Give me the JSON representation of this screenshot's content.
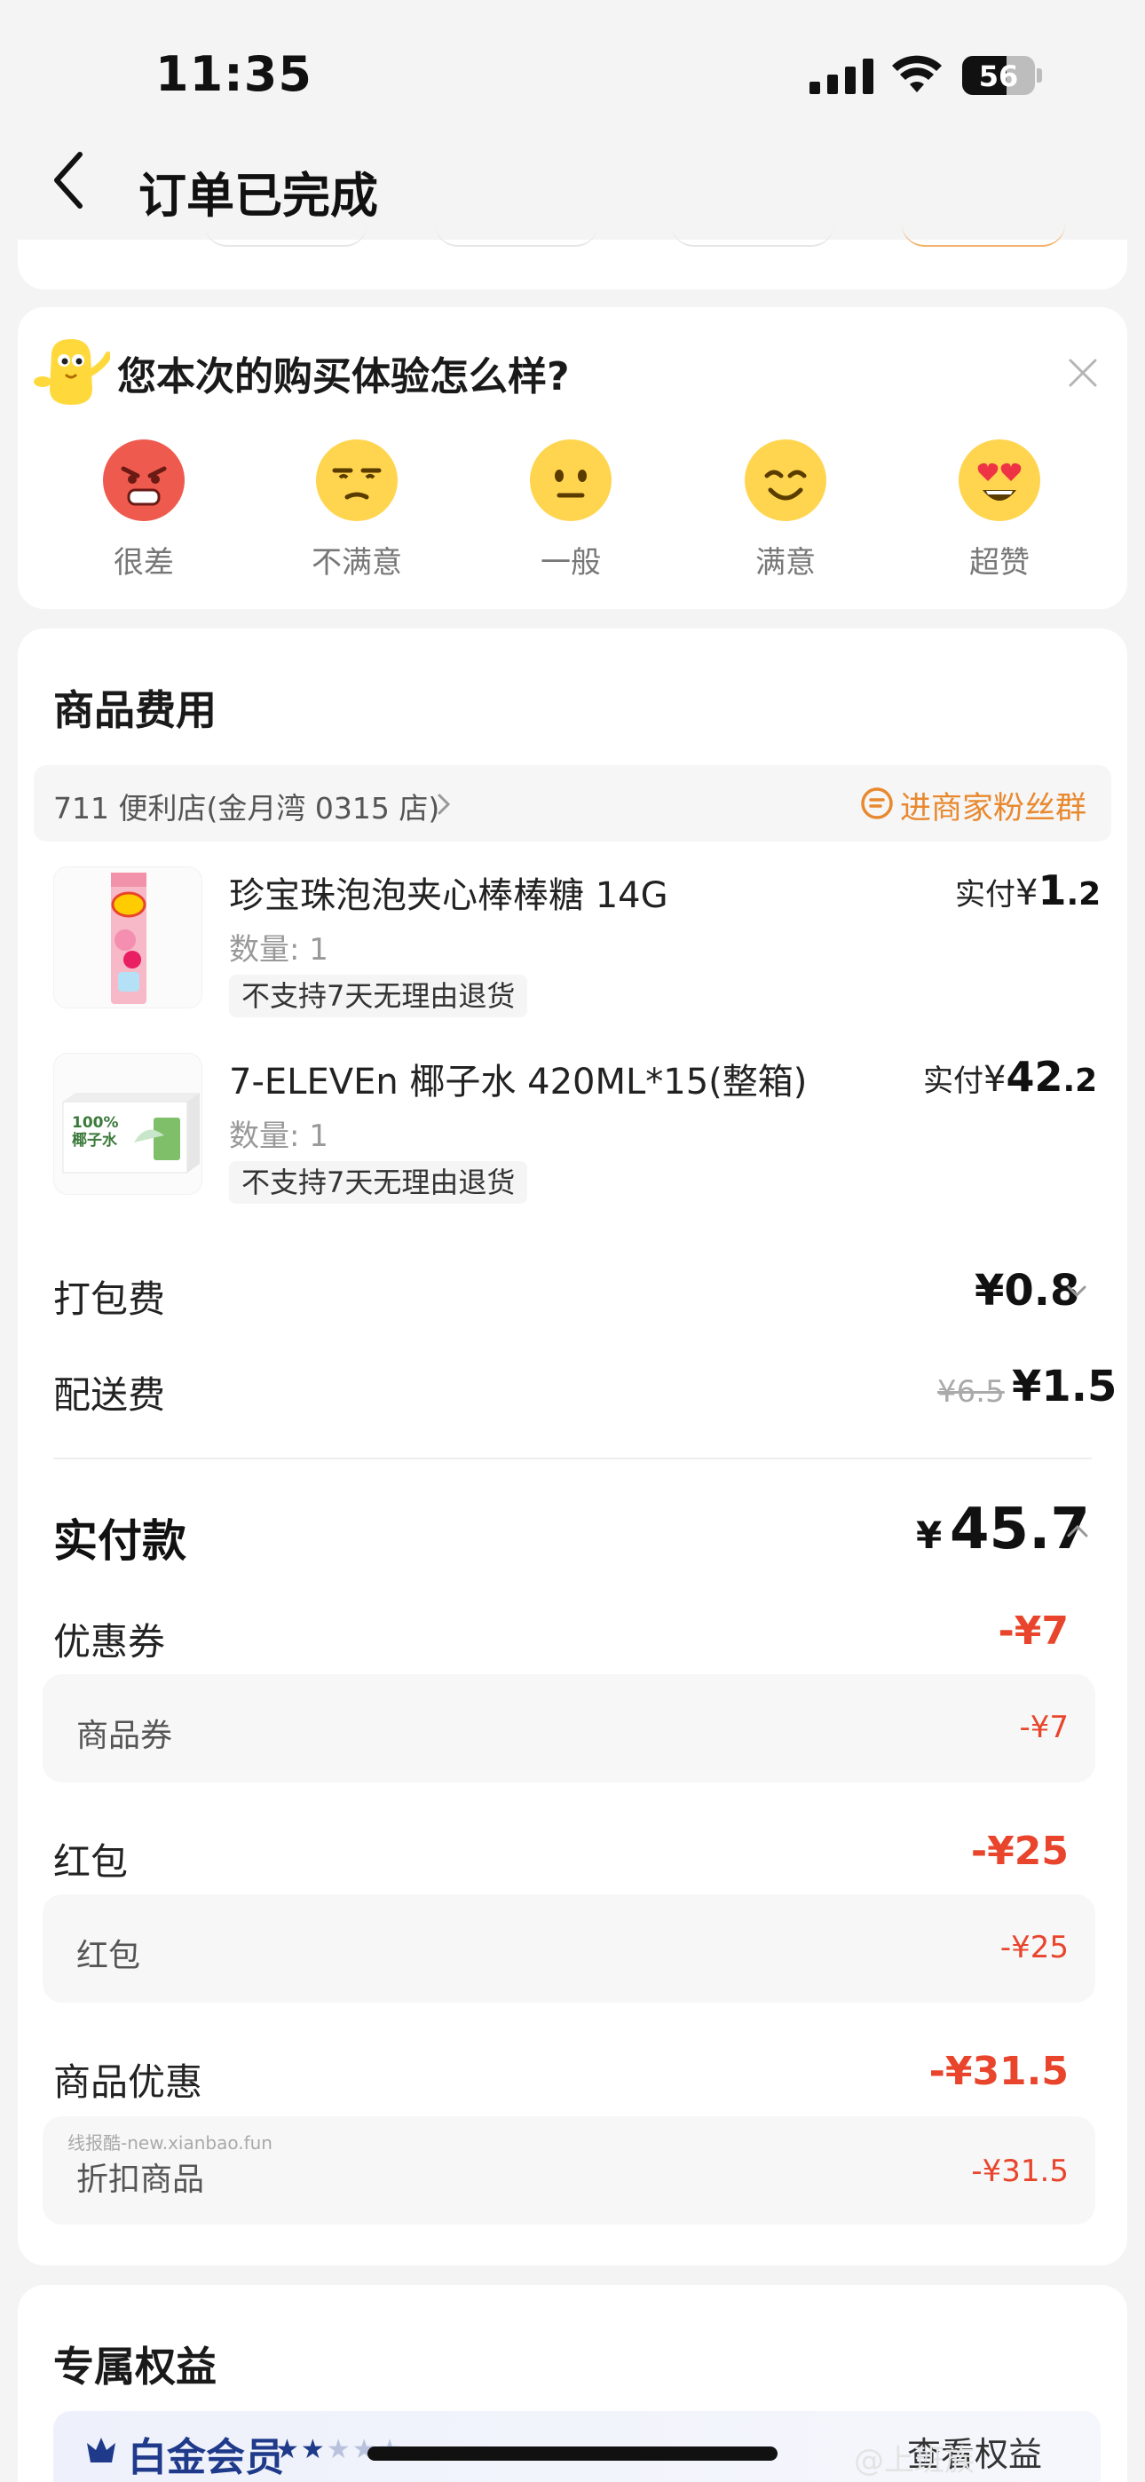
{
  "status": {
    "time": "11:35",
    "battery": "56"
  },
  "nav": {
    "title": "订单已完成"
  },
  "rating": {
    "title": "您本次的购买体验怎么样?",
    "options": [
      {
        "label": "很差",
        "icon": "angry-face-icon",
        "color": "#ef5a4f"
      },
      {
        "label": "不满意",
        "icon": "unamused-face-icon",
        "color": "#ffd54f"
      },
      {
        "label": "一般",
        "icon": "neutral-face-icon",
        "color": "#ffd54f"
      },
      {
        "label": "满意",
        "icon": "smiling-face-icon",
        "color": "#ffd54f"
      },
      {
        "label": "超赞",
        "icon": "heart-eyes-face-icon",
        "color": "#ffd54f"
      }
    ]
  },
  "fees": {
    "title": "商品费用",
    "store": {
      "name": "711 便利店(金月湾 0315 店)",
      "fan_group": "进商家粉丝群"
    },
    "items": [
      {
        "name": "珍宝珠泡泡夹心棒棒糖 14G",
        "qty": "数量: 1",
        "tag": "不支持7天无理由退货",
        "paid_label": "实付",
        "yen": "¥",
        "price_int": "1",
        "price_dec": ".2"
      },
      {
        "name": "7-ELEVEn 椰子水 420ML*15(整箱)",
        "qty": "数量: 1",
        "tag": "不支持7天无理由退货",
        "paid_label": "实付",
        "yen": "¥",
        "price_int": "42",
        "price_dec": ".2",
        "thumb_text": "100%\n椰子水"
      }
    ],
    "packing": {
      "label": "打包费",
      "value": "¥0.8"
    },
    "delivery": {
      "label": "配送费",
      "original": "¥6.5",
      "value": "¥1.5"
    },
    "total": {
      "label": "实付款",
      "yen": "¥",
      "value": "45.7"
    },
    "coupon": {
      "label": "优惠券",
      "value": "-¥7",
      "sub_label": "商品券",
      "sub_value": "-¥7"
    },
    "redpacket": {
      "label": "红包",
      "value": "-¥25",
      "sub_label": "红包",
      "sub_value": "-¥25"
    },
    "product_discount": {
      "label": "商品优惠",
      "value": "-¥31.5",
      "sub_label": "折扣商品",
      "sub_value": "-¥31.5",
      "watermark": "线报酷-new.xianbao.fun"
    }
  },
  "benefits": {
    "title": "专属权益",
    "member": "白金会员",
    "stars": "★★★★★",
    "view": "查看权益",
    "corner_watermark": "@上班族"
  },
  "colors": {
    "accent_orange": "#e8892f",
    "discount_red": "#e8452c",
    "member_blue": "#1f3a8a"
  }
}
